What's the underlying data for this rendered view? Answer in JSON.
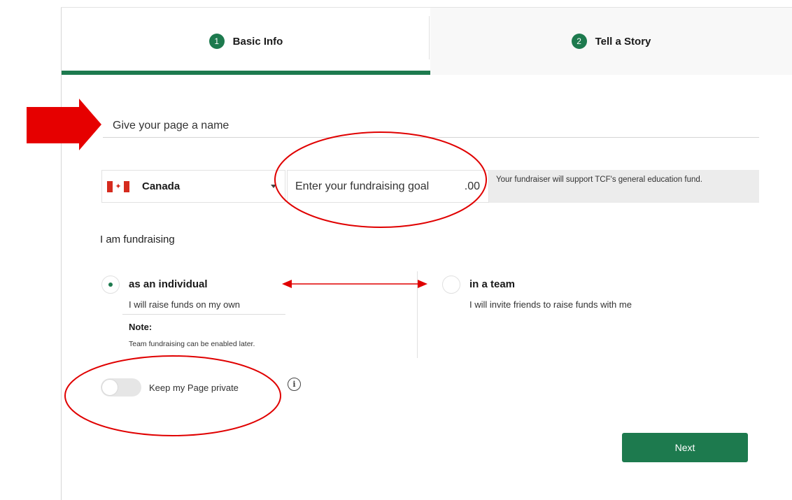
{
  "steps": [
    {
      "number": "1",
      "label": "Basic Info",
      "active": true
    },
    {
      "number": "2",
      "label": "Tell a Story",
      "active": false
    }
  ],
  "form": {
    "page_name_placeholder": "Give your page a name",
    "country": {
      "flag": "canada-flag-icon",
      "name": "Canada"
    },
    "goal_placeholder": "Enter your fundraising goal",
    "goal_cents": ".00",
    "support_text": "Your fundraiser will support TCF's general education fund.",
    "fundraising_label": "I am fundraising",
    "options": [
      {
        "title": "as an individual",
        "description": "I will raise funds on my own",
        "selected": true
      },
      {
        "title": "in a team",
        "description": "I will invite friends to raise funds with me",
        "selected": false
      }
    ],
    "note_title": "Note:",
    "note_text": "Team fundraising can be enabled later.",
    "private_label": "Keep my Page private",
    "private_enabled": false,
    "info_icon": "i",
    "next_label": "Next"
  },
  "colors": {
    "accent": "#1d7a4e",
    "annotation": "#e00000"
  }
}
